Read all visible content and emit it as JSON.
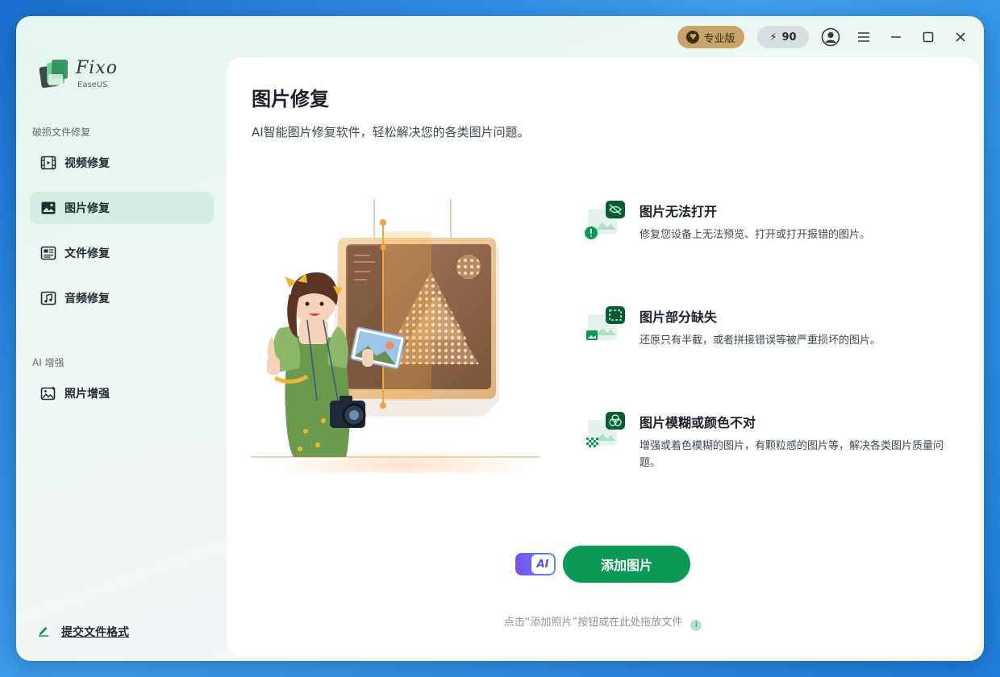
{
  "titlebar": {
    "pro_label": "专业版",
    "credits": "90",
    "icons": [
      "account-icon",
      "menu-icon",
      "minimize-icon",
      "maximize-icon",
      "close-icon"
    ]
  },
  "logo": {
    "name": "Fixo",
    "sub": "EaseUS"
  },
  "sidebar": {
    "section_repair": "破损文件修复",
    "items": [
      {
        "label": "视频修复",
        "icon": "video-icon"
      },
      {
        "label": "图片修复",
        "icon": "image-icon",
        "active": true
      },
      {
        "label": "文件修复",
        "icon": "document-icon"
      },
      {
        "label": "音频修复",
        "icon": "music-icon"
      }
    ],
    "section_ai": "AI 增强",
    "ai_items": [
      {
        "label": "照片增强",
        "icon": "photo-enhance-icon"
      }
    ],
    "submit_label": "提交文件格式"
  },
  "main": {
    "title": "图片修复",
    "subtitle": "AI智能图片修复软件，轻松解决您的各类图片问题。",
    "features": [
      {
        "title": "图片无法打开",
        "desc": "修复您设备上无法预览、打开或打开报错的图片。"
      },
      {
        "title": "图片部分缺失",
        "desc": "还原只有半截，或者拼接错误等被严重损坏的图片。"
      },
      {
        "title": "图片模糊或颜色不对",
        "desc": "增强或着色模糊的图片，有颗粒感的图片等，解决各类图片质量问题。"
      }
    ],
    "ai_toggle_label": "AI",
    "add_button": "添加图片",
    "hint": "点击“添加照片”按钮或在此处拖放文件"
  },
  "colors": {
    "accent": "#0a9a55",
    "active_nav": "#d3ede3",
    "pro_badge": "#c8a36a",
    "feature_icon": "#0b5a36"
  }
}
